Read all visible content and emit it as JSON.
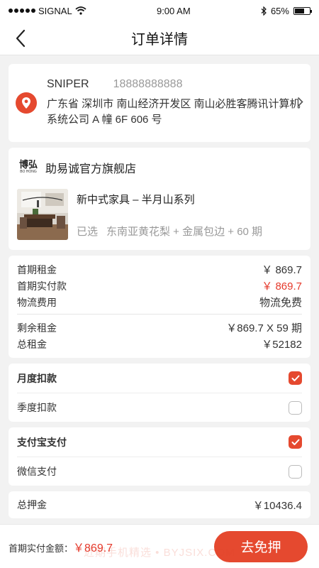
{
  "status_bar": {
    "carrier": "SIGNAL",
    "time": "9:00 AM",
    "battery": "65%",
    "battery_level": 0.65
  },
  "nav": {
    "title": "订单详情"
  },
  "address": {
    "name": "SNIPER",
    "phone": "18888888888",
    "text": "广东省 深圳市 南山经济开发区 南山必胜客腾讯计算机系统公司 A 幢 6F 606 号"
  },
  "store": {
    "logo_cn": "博弘",
    "logo_en": "BO HONG",
    "name": "助易诚官方旗舰店"
  },
  "product": {
    "name": "新中式家具 – 半月山系列",
    "chosen_label": "已选",
    "spec": "东南亚黄花梨 + 金属包边 + 60 期"
  },
  "fees": {
    "first_rent": {
      "label": "首期租金",
      "value": "￥ 869.7"
    },
    "first_paid": {
      "label": "首期实付款",
      "value": "￥ 869.7"
    },
    "shipping": {
      "label": "物流费用",
      "value": "物流免费"
    },
    "remaining": {
      "label": "剩余租金",
      "value": "￥869.7 X 59 期"
    },
    "total": {
      "label": "总租金",
      "value": "￥52182"
    }
  },
  "deduction": {
    "monthly": {
      "label": "月度扣款",
      "checked": true
    },
    "quarterly": {
      "label": "季度扣款",
      "checked": false
    }
  },
  "payment": {
    "alipay": {
      "label": "支付宝支付",
      "checked": true
    },
    "wechat": {
      "label": "微信支付",
      "checked": false
    }
  },
  "deposit": {
    "label": "总押金",
    "value": "￥10436.4"
  },
  "bottom": {
    "total_label": "首期实付金额：",
    "total_value": "￥869.7",
    "button": "去免押",
    "watermark": "近期手机精选 • BYJSIX.COM"
  },
  "colors": {
    "accent": "#e5492f",
    "price_red": "#e5392b"
  }
}
